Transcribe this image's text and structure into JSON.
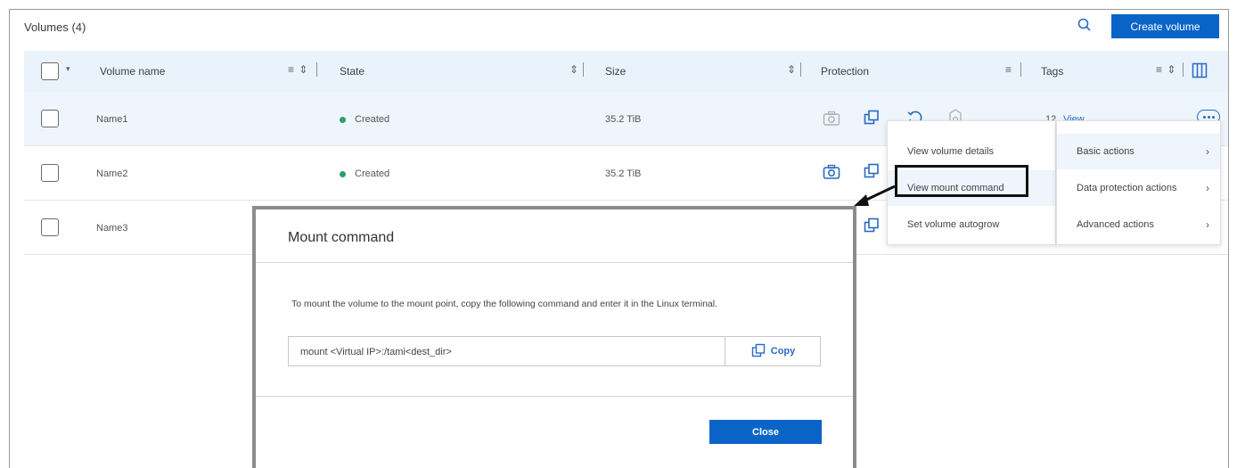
{
  "header": {
    "title": "Volumes (4)",
    "search_icon": "search-icon",
    "create_label": "Create volume"
  },
  "table": {
    "columns": [
      {
        "label": "Volume name",
        "controls": "≡ ⇕"
      },
      {
        "label": "State",
        "controls": "⇕"
      },
      {
        "label": "Size",
        "controls": "⇕"
      },
      {
        "label": "Protection",
        "controls": "≡"
      },
      {
        "label": "Tags",
        "controls": "≡ ⇕"
      }
    ],
    "rows": [
      {
        "name": "Name1",
        "state": "Created",
        "size": "35.2 TiB",
        "tags_count": "12",
        "tags_link": "View"
      },
      {
        "name": "Name2",
        "state": "Created",
        "size": "35.2 TiB"
      },
      {
        "name": "Name3"
      }
    ]
  },
  "menu": {
    "left": [
      "View volume details",
      "View mount command",
      "Set volume autogrow"
    ],
    "right": [
      "Basic actions",
      "Data protection actions",
      "Advanced actions"
    ]
  },
  "modal": {
    "title": "Mount command",
    "description": "To mount the volume to the mount point, copy the following command and enter it in the Linux terminal.",
    "command": "mount <Virtual IP>:/tami<dest_dir>",
    "copy_label": "Copy",
    "close_label": "Close"
  },
  "colors": {
    "primary": "#0a64c8",
    "link": "#2a6bc2",
    "status_created": "#2e9e6a",
    "header_bg": "#eaf3fb"
  }
}
